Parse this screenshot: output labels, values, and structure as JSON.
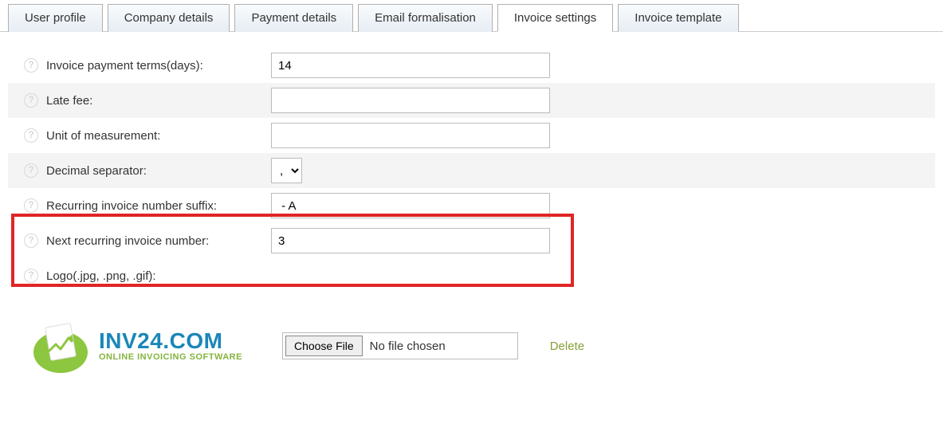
{
  "tabs": {
    "user_profile": "User profile",
    "company_details": "Company details",
    "payment_details": "Payment details",
    "email_formalisation": "Email formalisation",
    "invoice_settings": "Invoice settings",
    "invoice_template": "Invoice template",
    "active": "invoice_settings"
  },
  "form": {
    "payment_terms": {
      "label": "Invoice payment terms(days):",
      "value": "14"
    },
    "late_fee": {
      "label": "Late fee:",
      "value": ""
    },
    "unit": {
      "label": "Unit of measurement:",
      "value": ""
    },
    "decimal_separator": {
      "label": "Decimal separator:",
      "value": ","
    },
    "recurring_suffix": {
      "label": "Recurring invoice number suffix:",
      "value": " - A"
    },
    "next_recurring": {
      "label": "Next recurring invoice number:",
      "value": "3"
    },
    "logo": {
      "label": "Logo(.jpg, .png, .gif):"
    }
  },
  "file": {
    "choose_label": "Choose File",
    "status": "No file chosen",
    "delete_label": "Delete"
  },
  "brand": {
    "name": "INV24.COM",
    "tagline": "ONLINE INVOICING SOFTWARE"
  }
}
